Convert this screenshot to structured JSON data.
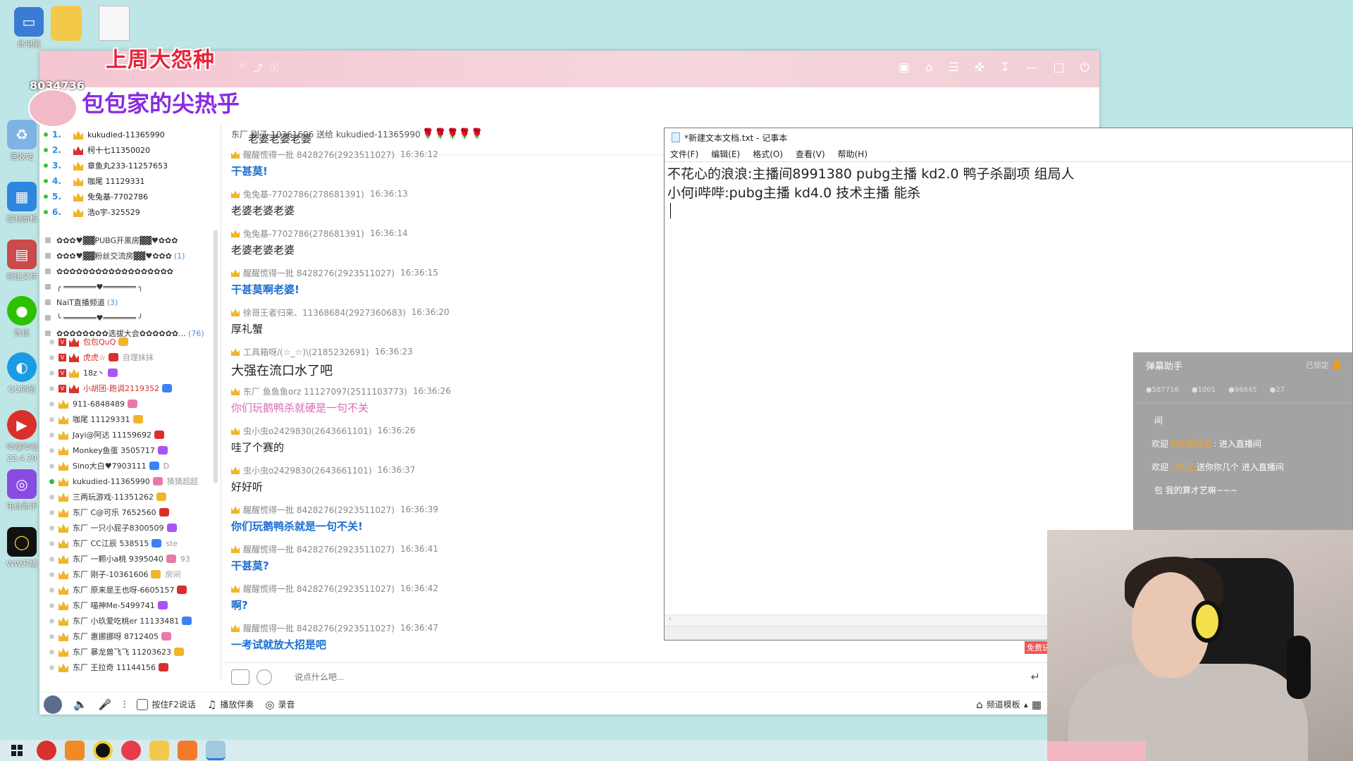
{
  "desktop": {
    "icons": [
      "此电脑",
      "回收站",
      "控制面板",
      "新建文件",
      "微信",
      "QQ浏览",
      "哔哩哔哩",
      "电台助手",
      "WW开播"
    ],
    "icons_extra": [
      "22.4.29"
    ]
  },
  "overlay": {
    "title": "上周大怨种",
    "subtitle": "包包家的尖热乎",
    "room_id": "8034736"
  },
  "chat_header": {
    "title": "老婆老婆老婆",
    "download_label": "⬇"
  },
  "ranking": [
    {
      "num": "1.",
      "name": "kukudied-11365990",
      "crown": "gold"
    },
    {
      "num": "2.",
      "name": "柯十七11350020",
      "crown": "red"
    },
    {
      "num": "3.",
      "name": "章鱼丸233-11257653",
      "crown": "gold"
    },
    {
      "num": "4.",
      "name": "咖尾 11129331",
      "crown": "gold"
    },
    {
      "num": "5.",
      "name": "免兔基-7702786",
      "crown": "gold"
    },
    {
      "num": "6.",
      "name": "浩o宇-325529",
      "crown": "gold"
    }
  ],
  "channels": [
    {
      "name": "✿✿✿♥▓▓PUBG开黑房▓▓♥✿✿✿",
      "count": ""
    },
    {
      "name": "✿✿✿♥▓▓粉丝交流房▓▓♥✿✿✿",
      "count": "(1)"
    },
    {
      "name": "✿✿✿✿✿✿✿✿✿✿✿✿✿✿✿✿✿✿",
      "count": ""
    },
    {
      "name": "╭ ═══════♥═══════ ╮",
      "count": ""
    },
    {
      "name": "NaiT直播频道",
      "count": "(3)"
    },
    {
      "name": "╰ ═══════♥═══════ ╯",
      "count": ""
    },
    {
      "name": "✿✿✿✿✿✿✿✿选拔大会✿✿✿✿✿✿…",
      "count": "(76)"
    }
  ],
  "users": [
    {
      "name": "包包QuQ",
      "red": true,
      "v": true,
      "online": false,
      "extra": ""
    },
    {
      "name": "虎虎☆",
      "red": true,
      "v": true,
      "online": false,
      "extra": "自理抹抹"
    },
    {
      "name": "18z丶",
      "red": false,
      "v": true,
      "online": false,
      "extra": ""
    },
    {
      "name": "小胡团-跑调2119352",
      "red": true,
      "v": true,
      "online": false,
      "extra": ""
    },
    {
      "name": "911-6848489",
      "red": false,
      "v": false,
      "online": false,
      "extra": ""
    },
    {
      "name": "咖尾 11129331",
      "red": false,
      "v": false,
      "online": false,
      "extra": ""
    },
    {
      "name": "Jayi@阿达 11159692",
      "red": false,
      "v": false,
      "online": false,
      "extra": ""
    },
    {
      "name": "Monkey鱼蛋 3505717",
      "red": false,
      "v": false,
      "online": false,
      "extra": ""
    },
    {
      "name": "Sino大白♥7903111",
      "red": false,
      "v": false,
      "online": false,
      "extra": "D"
    },
    {
      "name": "kukudied-11365990",
      "red": false,
      "v": false,
      "online": true,
      "extra": "猜猜超超"
    },
    {
      "name": "三两玩游戏-11351262",
      "red": false,
      "v": false,
      "online": false,
      "extra": ""
    },
    {
      "name": "东厂 C@可乐 7652560",
      "red": false,
      "v": false,
      "online": false,
      "extra": ""
    },
    {
      "name": "东厂 一只小屁子8300509",
      "red": false,
      "v": false,
      "online": false,
      "extra": ""
    },
    {
      "name": "东厂 CC江辰 538515",
      "red": false,
      "v": false,
      "online": false,
      "extra": "ste"
    },
    {
      "name": "东厂 一颗小a桃 9395040",
      "red": false,
      "v": false,
      "online": false,
      "extra": "93"
    },
    {
      "name": "东厂 刚子-10361606",
      "red": false,
      "v": false,
      "online": false,
      "extra": "房间"
    },
    {
      "name": "东厂 原来是王也呀-6605157",
      "red": false,
      "v": false,
      "online": false,
      "extra": ""
    },
    {
      "name": "东厂 喵神Me-5499741",
      "red": false,
      "v": false,
      "online": false,
      "extra": ""
    },
    {
      "name": "东厂 小玖爱吃桃er 11133481",
      "red": false,
      "v": false,
      "online": false,
      "extra": ""
    },
    {
      "name": "东厂 惠挪挪呀 8712405",
      "red": false,
      "v": false,
      "online": false,
      "extra": ""
    },
    {
      "name": "东厂 暴龙兽飞飞 11203623",
      "red": false,
      "v": false,
      "online": false,
      "extra": ""
    },
    {
      "name": "东厂 王拉奇 11144156",
      "red": false,
      "v": false,
      "online": false,
      "extra": ""
    }
  ],
  "gift_line": {
    "text": "东厂 刚子-10361606 送给 kukudied-11365990",
    "roses": "🌹🌹🌹🌹🌹"
  },
  "messages": [
    {
      "user": "醒醒慌得一批 8428276(2923511027)",
      "time": "16:36:12",
      "text": "干甚莫!",
      "style": "blue"
    },
    {
      "user": "兔兔基-7702786(278681391)",
      "time": "16:36:13",
      "text": "老婆老婆老婆",
      "style": ""
    },
    {
      "user": "兔兔基-7702786(278681391)",
      "time": "16:36:14",
      "text": "老婆老婆老婆",
      "style": ""
    },
    {
      "user": "醒醒慌得一批 8428276(2923511027)",
      "time": "16:36:15",
      "text": "干甚莫啊老婆!",
      "style": "blue"
    },
    {
      "user": "徐哥王者归来、11368684(2927360683)",
      "time": "16:36:20",
      "text": "厚礼蟹",
      "style": ""
    },
    {
      "user": "工具箱呀/(☆_☆)\\(2185232691)",
      "time": "16:36:23",
      "text": "大强在流口水了吧",
      "style": "big"
    },
    {
      "user": "东厂 鱼鱼鱼orz 11127097(2511103773)",
      "time": "16:36:26",
      "text": "你们玩鹅鸭杀就硬是一句不关",
      "style": "pink"
    },
    {
      "user": "虫小虫o2429830(2643661101)",
      "time": "16:36:26",
      "text": "哇了个赛的",
      "style": ""
    },
    {
      "user": "虫小虫o2429830(2643661101)",
      "time": "16:36:37",
      "text": "好好听",
      "style": ""
    },
    {
      "user": "醒醒慌得一批 8428276(2923511027)",
      "time": "16:36:39",
      "text": "你们玩鹅鸭杀就是一句不关!",
      "style": "blue"
    },
    {
      "user": "醒醒慌得一批 8428276(2923511027)",
      "time": "16:36:41",
      "text": "干甚莫?",
      "style": "blue"
    },
    {
      "user": "醒醒慌得一批 8428276(2923511027)",
      "time": "16:36:42",
      "text": "啊?",
      "style": "blue"
    },
    {
      "user": "醒醒慌得一批 8428276(2923511027)",
      "time": "16:36:47",
      "text": "一考试就放大招是吧",
      "style": "blue"
    }
  ],
  "input": {
    "placeholder": "说点什么吧..."
  },
  "bottom_bar": {
    "ptt": "按住F2说话",
    "music": "播放伴奏",
    "record": "录音",
    "template": "频道模板",
    "free": "免费玩"
  },
  "notepad": {
    "title": "*新建文本文档.txt - 记事本",
    "menu": [
      "文件(F)",
      "编辑(E)",
      "格式(O)",
      "查看(V)",
      "帮助(H)"
    ],
    "lines": [
      "不花心的浪浪:主播间8991380 pubg主播 kd2.0 鸭子杀副项 组局人",
      "小何i哔哔:pubg主播 kd4.0 技术主播  能杀"
    ]
  },
  "danmaku": {
    "title": "弹幕助手",
    "locked": "已锁定",
    "stats": [
      "587716",
      "1001",
      "96645",
      "27"
    ],
    "lines": [
      {
        "pre": "",
        "hl": "",
        "post": "间"
      },
      {
        "pre": "欢迎",
        "hl": "包包家豆豆",
        "post": ": 进入直播间"
      },
      {
        "pre": "欢迎",
        "hl": "小胡团",
        "post": "送你你几个 进入直播间"
      },
      {
        "pre": "",
        "hl": "",
        "post": "包 我的算才艺嘛~~~"
      }
    ]
  },
  "colors": {
    "accent_blue": "#1c6fd1",
    "rank_blue": "#2a8ee6",
    "title_pink": "#f3c6d2"
  }
}
